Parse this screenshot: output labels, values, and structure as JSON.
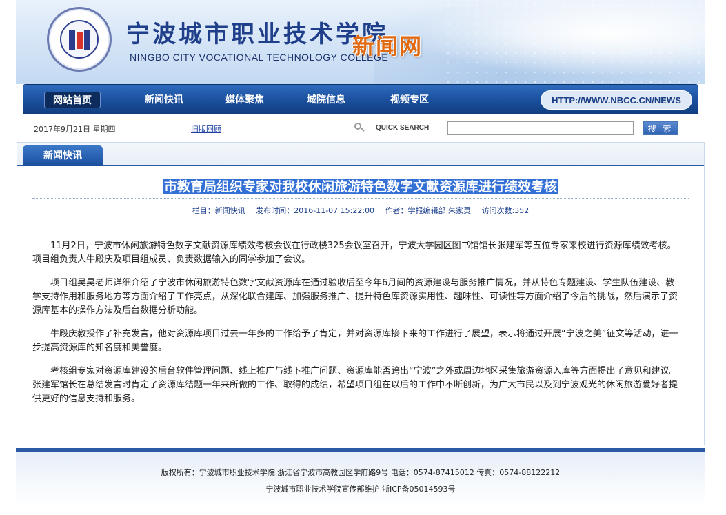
{
  "header": {
    "school_name_cn": "宁波城市职业技术学院",
    "school_name_en": "NINGBO CITY VOCATIONAL TECHNOLOGY COLLEGE",
    "site_name": "新闻网"
  },
  "nav": {
    "items": [
      {
        "label": "网站首页"
      },
      {
        "label": "新闻快讯"
      },
      {
        "label": "媒体聚焦"
      },
      {
        "label": "城院信息"
      },
      {
        "label": "视频专区"
      }
    ],
    "site_url": "HTTP://WWW.NBCC.CN/NEWS"
  },
  "toolbar": {
    "date": "2017年9月21日 星期四",
    "old_version_link": "旧版回顾",
    "quick_search_label": "QUICK SEARCH",
    "search_value": "",
    "search_button": "搜 索"
  },
  "section": {
    "tab_label": "新闻快讯"
  },
  "article": {
    "title": "市教育局组织专家对我校休闲旅游特色数字文献资源库进行绩效考核",
    "column": "栏目：新闻快讯",
    "publish_time": "发布时间：2016-11-07 15:22:00",
    "author": "作者：学报编辑部 朱家灵",
    "visits": "访问次数:352",
    "paragraphs": [
      "11月2日，宁波市休闲旅游特色数字文献资源库绩效考核会议在行政楼325会议室召开，宁波大学园区图书馆馆长张建军等五位专家来校进行资源库绩效考核。项目组负责人牛殿庆及项目组成员、负责数据输入的同学参加了会议。",
      "项目组吴昊老师详细介绍了宁波市休闲旅游特色数字文献资源库在通过验收后至今年6月间的资源建设与服务推广情况，并从特色专题建设、学生队伍建设、教学支持作用和服务地方等方面介绍了工作亮点，从深化联合建库、加强服务推广、提升特色库资源实用性、趣味性、可读性等方面介绍了今后的挑战，然后演示了资源库基本的操作方法及后台数据分析功能。",
      "牛殿庆教授作了补充发言，他对资源库项目过去一年多的工作给予了肯定，并对资源库接下来的工作进行了展望，表示将通过开展“宁波之美”征文等活动，进一步提高资源库的知名度和美誉度。",
      "考核组专家对资源库建设的后台软件管理问题、线上推广与线下推广问题、资源库能否跨出“宁波”之外或周边地区采集旅游资源入库等方面提出了意见和建议。张建军馆长在总结发言时肯定了资源库结题一年来所做的工作、取得的成绩，希望项目组在以后的工作中不断创新，为广大市民以及到宁波观光的休闲旅游爱好者提供更好的信息支持和服务。"
    ]
  },
  "footer": {
    "copyright": "版权所有：宁波城市职业技术学院 浙江省宁波市高教园区学府路9号 电话：0574-87415012 传真：0574-88122212",
    "maintainer": "宁波城市职业技术学院宣传部维护 浙ICP备05014593号"
  },
  "colors": {
    "nav_blue": "#1a4f9c",
    "title_highlight": "#3370d6",
    "site_name_orange": "#e06a12"
  }
}
